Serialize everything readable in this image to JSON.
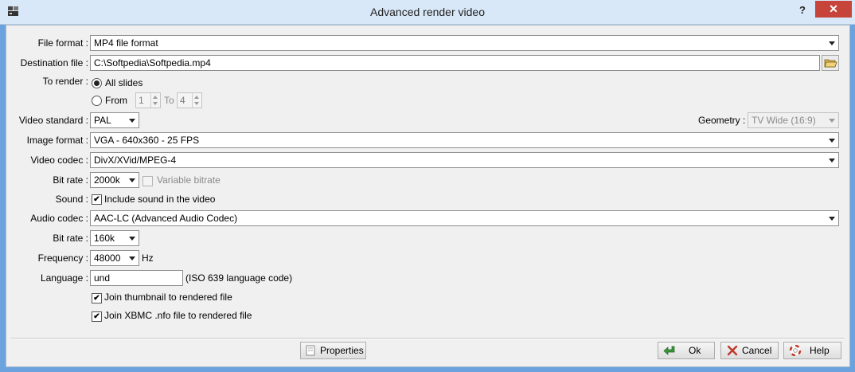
{
  "window": {
    "title": "Advanced render video",
    "help": "?",
    "close": "✕"
  },
  "fields": {
    "file_format": {
      "label": "File format :",
      "value": "MP4 file format"
    },
    "destination": {
      "label": "Destination file :",
      "value": "C:\\Softpedia\\Softpedia.mp4"
    },
    "to_render": {
      "label": "To render :",
      "all_slides": "All slides",
      "from": "From",
      "from_value": "1",
      "to": "To",
      "to_value": "4"
    },
    "video_standard": {
      "label": "Video standard :",
      "value": "PAL"
    },
    "geometry": {
      "label": "Geometry :",
      "value": "TV Wide (16:9)"
    },
    "image_format": {
      "label": "Image format :",
      "value": "VGA - 640x360 - 25 FPS"
    },
    "video_codec": {
      "label": "Video codec :",
      "value": "DivX/XVid/MPEG-4"
    },
    "video_bitrate": {
      "label": "Bit rate :",
      "value": "2000k",
      "variable": "Variable bitrate"
    },
    "sound": {
      "label": "Sound :",
      "include": "Include sound in the video"
    },
    "audio_codec": {
      "label": "Audio codec :",
      "value": "AAC-LC (Advanced Audio Codec)"
    },
    "audio_bitrate": {
      "label": "Bit rate :",
      "value": "160k"
    },
    "frequency": {
      "label": "Frequency :",
      "value": "48000",
      "unit": "Hz"
    },
    "language": {
      "label": "Language :",
      "value": "und",
      "hint": "(ISO 639 language code)"
    },
    "join_thumbnail": "Join thumbnail to rendered file",
    "join_xbmc": "Join XBMC .nfo file to rendered file"
  },
  "buttons": {
    "properties": "Properties",
    "ok": "Ok",
    "cancel": "Cancel",
    "help": "Help"
  }
}
